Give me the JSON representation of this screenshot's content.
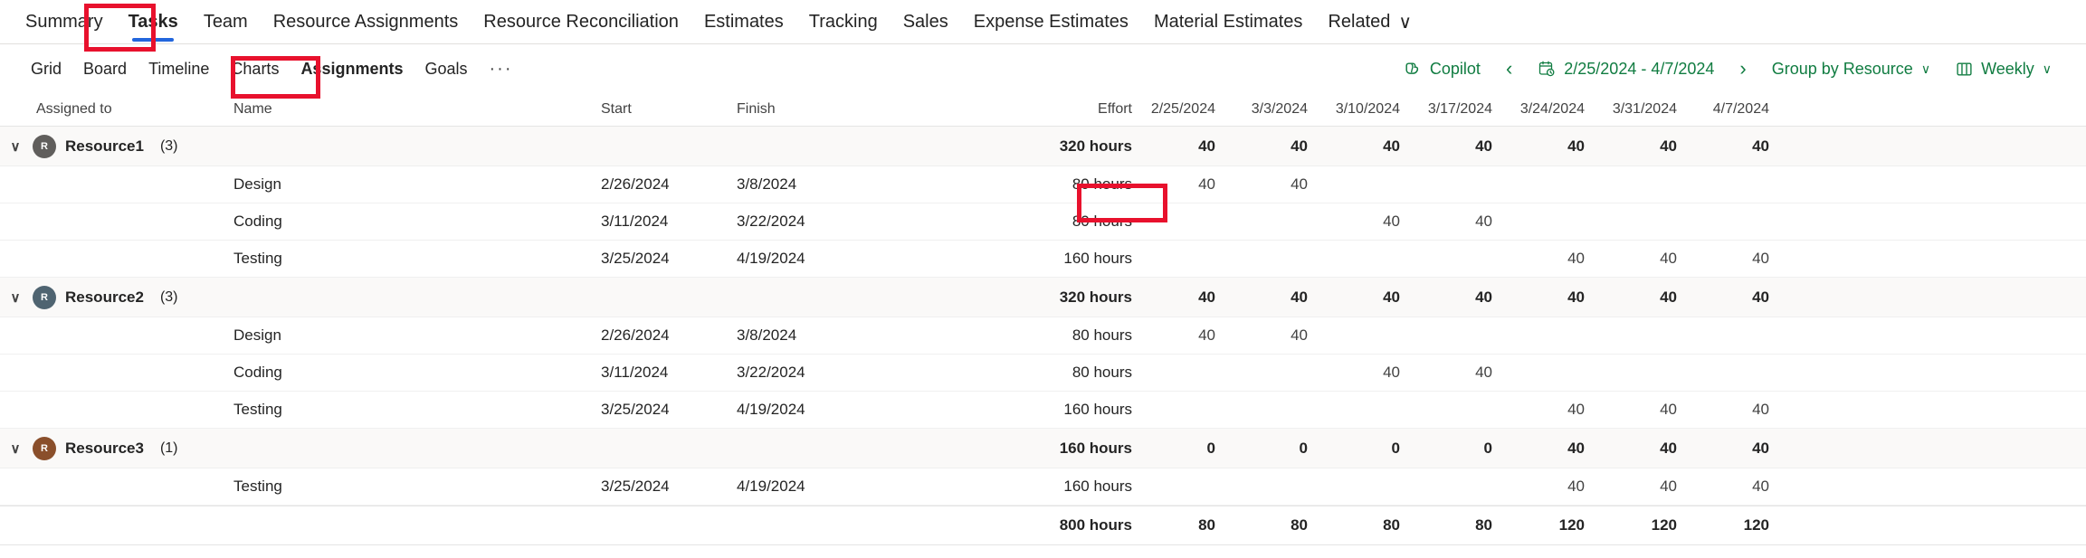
{
  "entity_tabs": [
    {
      "label": "Summary",
      "active": false
    },
    {
      "label": "Tasks",
      "active": true
    },
    {
      "label": "Team",
      "active": false
    },
    {
      "label": "Resource Assignments",
      "active": false
    },
    {
      "label": "Resource Reconciliation",
      "active": false
    },
    {
      "label": "Estimates",
      "active": false
    },
    {
      "label": "Tracking",
      "active": false
    },
    {
      "label": "Sales",
      "active": false
    },
    {
      "label": "Expense Estimates",
      "active": false
    },
    {
      "label": "Material Estimates",
      "active": false
    },
    {
      "label": "Related",
      "active": false,
      "chevron": "∨"
    }
  ],
  "view_tabs": [
    {
      "label": "Grid",
      "active": false
    },
    {
      "label": "Board",
      "active": false
    },
    {
      "label": "Timeline",
      "active": false
    },
    {
      "label": "Charts",
      "active": false
    },
    {
      "label": "Assignments",
      "active": true
    },
    {
      "label": "Goals",
      "active": false
    },
    {
      "label": "···",
      "active": false
    }
  ],
  "toolbar": {
    "copilot_label": "Copilot",
    "copilot_icon": "copilot-icon",
    "prev_label": "‹",
    "next_label": "›",
    "date_range": "2/25/2024 - 4/7/2024",
    "date_icon": "calendar-clock-icon",
    "group_by_label": "Group by Resource",
    "group_by_chevron": "∨",
    "scale_label": "Weekly",
    "scale_icon": "columns-icon",
    "scale_chevron": "∨",
    "accent_color": "#107c41"
  },
  "grid": {
    "columns": {
      "assigned_to": "Assigned to",
      "name": "Name",
      "start": "Start",
      "finish": "Finish",
      "effort": "Effort"
    },
    "week_columns": [
      "2/25/2024",
      "3/3/2024",
      "3/10/2024",
      "3/17/2024",
      "3/24/2024",
      "3/31/2024",
      "4/7/2024"
    ],
    "groups": [
      {
        "expand_icon": "∨",
        "avatar_initial": "R",
        "avatar_color": "#605e5c",
        "name": "Resource1",
        "count": "(3)",
        "effort": "320 hours",
        "weeks": [
          "40",
          "40",
          "40",
          "40",
          "40",
          "40",
          "40"
        ],
        "tasks": [
          {
            "name": "Design",
            "start": "2/26/2024",
            "finish": "3/8/2024",
            "effort": "80 hours",
            "weeks": [
              "40",
              "40",
              "",
              "",
              "",
              "",
              ""
            ]
          },
          {
            "name": "Coding",
            "start": "3/11/2024",
            "finish": "3/22/2024",
            "effort": "80 hours",
            "weeks": [
              "",
              "",
              "40",
              "40",
              "",
              "",
              ""
            ]
          },
          {
            "name": "Testing",
            "start": "3/25/2024",
            "finish": "4/19/2024",
            "effort": "160 hours",
            "weeks": [
              "",
              "",
              "",
              "",
              "40",
              "40",
              "40"
            ]
          }
        ]
      },
      {
        "expand_icon": "∨",
        "avatar_initial": "R",
        "avatar_color": "#4f6471",
        "name": "Resource2",
        "count": "(3)",
        "effort": "320 hours",
        "weeks": [
          "40",
          "40",
          "40",
          "40",
          "40",
          "40",
          "40"
        ],
        "tasks": [
          {
            "name": "Design",
            "start": "2/26/2024",
            "finish": "3/8/2024",
            "effort": "80 hours",
            "weeks": [
              "40",
              "40",
              "",
              "",
              "",
              "",
              ""
            ]
          },
          {
            "name": "Coding",
            "start": "3/11/2024",
            "finish": "3/22/2024",
            "effort": "80 hours",
            "weeks": [
              "",
              "",
              "40",
              "40",
              "",
              "",
              ""
            ]
          },
          {
            "name": "Testing",
            "start": "3/25/2024",
            "finish": "4/19/2024",
            "effort": "160 hours",
            "weeks": [
              "",
              "",
              "",
              "",
              "40",
              "40",
              "40"
            ]
          }
        ]
      },
      {
        "expand_icon": "∨",
        "avatar_initial": "R",
        "avatar_color": "#8a4f2b",
        "name": "Resource3",
        "count": "(1)",
        "effort": "160 hours",
        "weeks": [
          "0",
          "0",
          "0",
          "0",
          "40",
          "40",
          "40"
        ],
        "tasks": [
          {
            "name": "Testing",
            "start": "3/25/2024",
            "finish": "4/19/2024",
            "effort": "160 hours",
            "weeks": [
              "",
              "",
              "",
              "",
              "40",
              "40",
              "40"
            ]
          }
        ]
      }
    ],
    "total_row": {
      "effort": "800 hours",
      "weeks": [
        "80",
        "80",
        "80",
        "80",
        "120",
        "120",
        "120"
      ]
    }
  },
  "annotations": {
    "highlight_color": "#e8112d",
    "boxes": [
      "tasks-tab",
      "assignments-tab",
      "design-week2-cell"
    ]
  }
}
